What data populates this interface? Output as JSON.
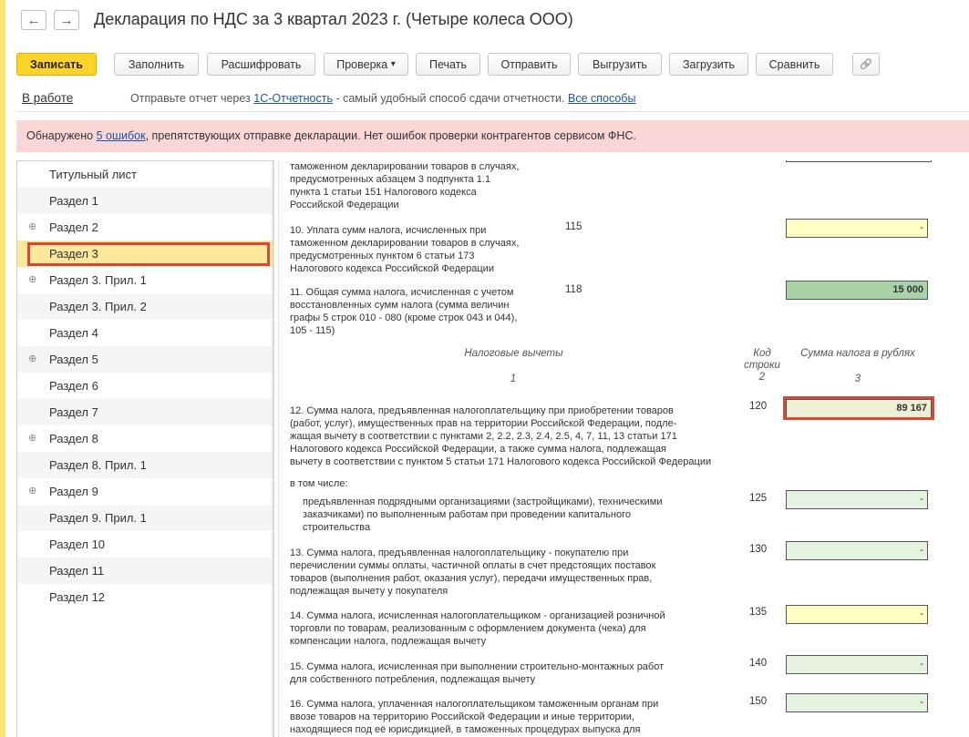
{
  "window": {
    "title": "Декларация по НДС за 3 квартал 2023 г. (Четыре колеса ООО)",
    "back_icon": "←",
    "forward_icon": "→"
  },
  "toolbar": {
    "save": "Записать",
    "fill": "Заполнить",
    "decode": "Расшифровать",
    "check": "Проверка",
    "check_arrow": "▾",
    "print": "Печать",
    "send": "Отправить",
    "export": "Выгрузить",
    "import": "Загрузить",
    "compare": "Сравнить",
    "attach_icon": "🔗"
  },
  "status": {
    "state": "В работе",
    "msg_prefix": "Отправьте отчет через ",
    "msg_link": "1С-Отчетность",
    "msg_suffix": " - самый удобный способ сдачи отчетности. ",
    "all_ways": "Все способы"
  },
  "banner": {
    "prefix": "Обнаружено ",
    "link": "5 ошибок",
    "suffix": ", препятствующих отправке декларации. Нет ошибок проверки контрагентов сервисом ФНС."
  },
  "sidebar": {
    "expand_icon": "⊕",
    "items": [
      {
        "label": "Титульный лист"
      },
      {
        "label": "Раздел 1"
      },
      {
        "label": "Раздел 2"
      },
      {
        "label": "Раздел 3"
      },
      {
        "label": "Раздел 3. Прил. 1"
      },
      {
        "label": "Раздел 3. Прил. 2"
      },
      {
        "label": "Раздел 4"
      },
      {
        "label": "Раздел 5"
      },
      {
        "label": "Раздел 6"
      },
      {
        "label": "Раздел 7"
      },
      {
        "label": "Раздел 8"
      },
      {
        "label": "Раздел 8. Прил. 1"
      },
      {
        "label": "Раздел 9"
      },
      {
        "label": "Раздел 9. Прил. 1"
      },
      {
        "label": "Раздел 10"
      },
      {
        "label": "Раздел 11"
      },
      {
        "label": "Раздел 12"
      }
    ]
  },
  "form": {
    "r9_text": [
      "таможенном декларировании товаров в случаях,",
      "предусмотренных абзацем 3 подпункта 1.1",
      "пункта 1 статьи 151 Налогового кодекса",
      "Российской Федерации"
    ],
    "r10_text": [
      "10. Уплата сумм налога, исчисленных при",
      "таможенном декларировании товаров в случаях,",
      "предусмотренных пунктом 6 статьи 173",
      "Налогового кодекса Российской Федерации"
    ],
    "r10_code": "115",
    "r10_value": "-",
    "r11_text": [
      "11. Общая сумма налога, исчисленная с учетом",
      "восстановленных сумм налога (сумма величин",
      "графы 5 строк 010 - 080 (кроме строк 043 и 044),",
      "105 - 115)"
    ],
    "r11_code": "118",
    "r11_value": "15 000",
    "hdr_col1": "Налоговые вычеты",
    "hdr_col2": [
      "Код",
      "строки"
    ],
    "hdr_col3": "Сумма налога в рублях",
    "hdr_num1": "1",
    "hdr_num2": "2",
    "hdr_num3": "3",
    "r12_text": [
      "12. Сумма налога, предъявленная налогоплательщику при приобретении товаров",
      "(работ, услуг), имущественных прав на территории Российской Федерации, подле-",
      "жащая вычету в соответствии с пунктами 2, 2.2, 2.3, 2.4, 2.5, 4, 7, 11, 13 статьи 171",
      "Налогового кодекса Российской Федерации, а также сумма налога, подлежащая",
      "вычету в соответствии с пунктом 5 статьи 171 Налогового кодекса Российской Федерации"
    ],
    "r12_code": "120",
    "r12_value": "89 167",
    "incl": "в том числе:",
    "r125_text": [
      "предъявленная подрядными организациями (застройщиками), техническими",
      "заказчиками) по выполненным работам при проведении капитального",
      "строительства"
    ],
    "r125_code": "125",
    "r125_value": "-",
    "r13_text": [
      "13. Сумма налога, предъявленная налогоплательщику - покупателю при",
      "перечислении суммы оплаты, частичной оплаты в счет предстоящих поставок",
      "товаров (выполнения работ, оказания услуг), передачи имущественных прав,",
      "подлежащая вычету у покупателя"
    ],
    "r13_code": "130",
    "r13_value": "-",
    "r14_text": [
      "14. Сумма налога, исчисленная налогоплательщиком - организацией розничной",
      "торговли по товарам, реализованным с оформлением документа (чека) для",
      "компенсации налога, подлежащая вычету"
    ],
    "r14_code": "135",
    "r14_value": "-",
    "r15_text": [
      "15. Сумма налога, исчисленная при выполнении строительно-монтажных работ",
      "для собственного потребления, подлежащая вычету"
    ],
    "r15_code": "140",
    "r15_value": "-",
    "r16_text": [
      "16. Сумма налога, уплаченная налогоплательщиком таможенным органам при",
      "ввозе товаров на территорию Российской Федерации и иные территории,",
      "находящиеся под её юрисдикцией, в таможенных процедурах выпуска для"
    ],
    "r16_code": "150",
    "r16_value": "-"
  }
}
